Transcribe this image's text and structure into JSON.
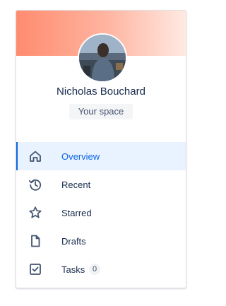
{
  "profile": {
    "name": "Nicholas Bouchard",
    "space_button_label": "Your space"
  },
  "colors": {
    "accent": "#0c66e4",
    "banner_start": "#ff8b6f",
    "banner_end": "#ffe9e2"
  },
  "nav": {
    "items": [
      {
        "label": "Overview",
        "icon": "home-icon",
        "active": true
      },
      {
        "label": "Recent",
        "icon": "history-icon"
      },
      {
        "label": "Starred",
        "icon": "star-icon"
      },
      {
        "label": "Drafts",
        "icon": "document-icon"
      },
      {
        "label": "Tasks",
        "icon": "checkbox-icon",
        "count": "0"
      }
    ]
  }
}
